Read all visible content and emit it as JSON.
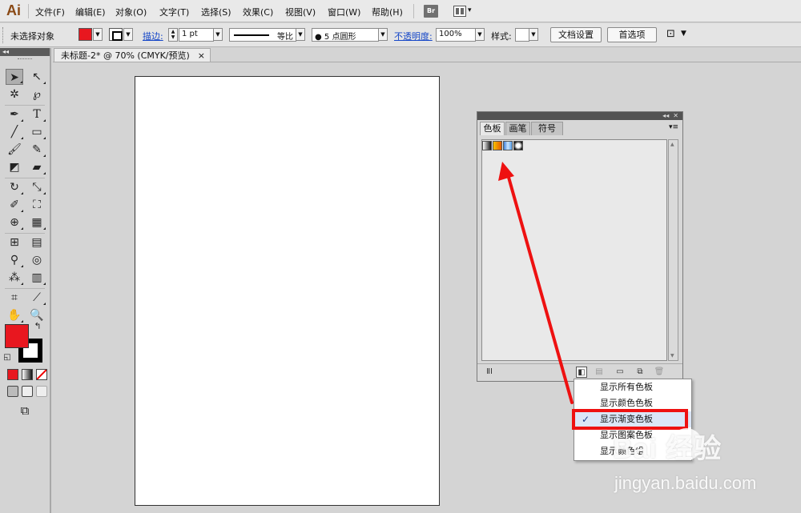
{
  "app": {
    "logo": "Ai"
  },
  "menus": [
    "文件(F)",
    "编辑(E)",
    "对象(O)",
    "文字(T)",
    "选择(S)",
    "效果(C)",
    "视图(V)",
    "窗口(W)",
    "帮助(H)"
  ],
  "menubar": {
    "bridge_label": "Br"
  },
  "control": {
    "selection_status": "未选择对象",
    "fill_color": "#e8171f",
    "stroke_label": "描边:",
    "stroke_weight": "1 pt",
    "stroke_profile": "等比",
    "brush": "● 5 点圆形",
    "opacity_label": "不透明度:",
    "opacity_value": "100%",
    "style_label": "样式:",
    "doc_setup_button": "文档设置",
    "preferences_button": "首选项"
  },
  "document": {
    "tab_title": "未标题-2* @ 70% (CMYK/预览)",
    "close": "×"
  },
  "tools": {
    "fill_color": "#e8171f",
    "stroke_color": "#000000"
  },
  "swatches_panel": {
    "tabs": [
      "色板",
      "画笔",
      "符号"
    ],
    "active_tab": "色板"
  },
  "context_menu": {
    "items": [
      "显示所有色板",
      "显示颜色色板",
      "显示渐变色板",
      "显示图案色板",
      "显示颜色组"
    ],
    "checked_index": 2,
    "check_mark": "✓"
  },
  "watermark": {
    "logo": "Bai  经验",
    "url": "jingyan.baidu.com"
  },
  "annotation": {
    "highlight_color": "#ee1111"
  }
}
